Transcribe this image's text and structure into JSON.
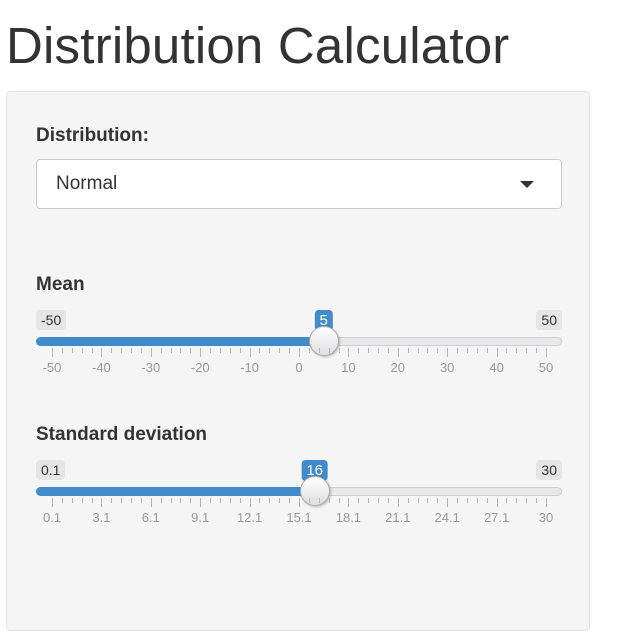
{
  "page": {
    "title": "Distribution Calculator"
  },
  "distribution": {
    "label": "Distribution:",
    "selected": "Normal"
  },
  "mean_slider": {
    "label": "Mean",
    "min": -50,
    "max": 50,
    "value": 5,
    "min_label": "-50",
    "max_label": "50",
    "value_label": "5",
    "ticks": [
      "-50",
      "-40",
      "-30",
      "-20",
      "-10",
      "0",
      "10",
      "20",
      "30",
      "40",
      "50"
    ]
  },
  "sd_slider": {
    "label": "Standard deviation",
    "min": 0.1,
    "max": 30,
    "value": 16,
    "min_label": "0.1",
    "max_label": "30",
    "value_label": "16",
    "ticks": [
      "0.1",
      "3.1",
      "6.1",
      "9.1",
      "12.1",
      "15.1",
      "18.1",
      "21.1",
      "24.1",
      "27.1",
      "30"
    ]
  },
  "colors": {
    "accent": "#428bca",
    "well": "#f5f5f5",
    "text": "#333333"
  }
}
